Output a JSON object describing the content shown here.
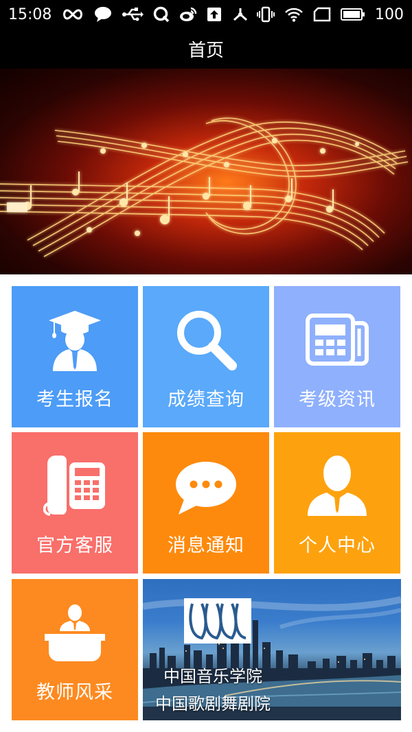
{
  "status_bar": {
    "time": "15:08",
    "battery_level": "100"
  },
  "header": {
    "title": "首页"
  },
  "banner": {
    "active_slide": 2,
    "slide_count": 2
  },
  "tiles": [
    {
      "label": "考生报名",
      "icon": "graduate-icon",
      "color": "#4d9cf7"
    },
    {
      "label": "成绩查询",
      "icon": "search-icon",
      "color": "#5aa9fa"
    },
    {
      "label": "考级资讯",
      "icon": "newspaper-icon",
      "color": "#8fb0fc"
    },
    {
      "label": "官方客服",
      "icon": "telephone-icon",
      "color": "#f96f6a"
    },
    {
      "label": "消息通知",
      "icon": "chat-bubble-icon",
      "color": "#fd8a0c"
    },
    {
      "label": "个人中心",
      "icon": "user-icon",
      "color": "#fda20e"
    },
    {
      "label": "教师风采",
      "icon": "teacher-podium-icon",
      "color": "#fd8a20"
    }
  ],
  "promo": {
    "line1": "中国音乐学院",
    "line2": "中国歌剧舞剧院"
  },
  "colors": {
    "dot_inactive": "#9a9a9a",
    "dot_active": "#ff1f6e"
  }
}
